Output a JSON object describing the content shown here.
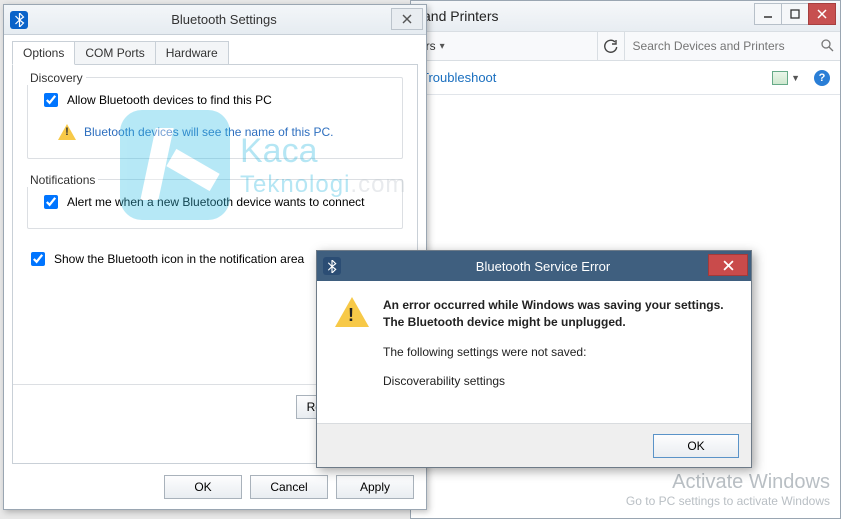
{
  "devicesWindow": {
    "title": "and Printers",
    "crumb": "ers",
    "searchPlaceholder": "Search Devices and Printers",
    "troubleshoot": "Troubleshoot",
    "help": "?"
  },
  "activate": {
    "l1": "Activate Windows",
    "l2": "Go to PC settings to activate Windows"
  },
  "btSettings": {
    "title": "Bluetooth Settings",
    "tabs": {
      "options": "Options",
      "com": "COM Ports",
      "hw": "Hardware"
    },
    "discovery": {
      "label": "Discovery",
      "allow": "Allow Bluetooth devices to find this PC",
      "hint": "Bluetooth devices will see the name of this PC."
    },
    "notifications": {
      "label": "Notifications",
      "alert": "Alert me when a new Bluetooth device wants to connect"
    },
    "showIcon": "Show the Bluetooth icon in the notification area",
    "buttons": {
      "restore": "Restore Defaults",
      "ok": "OK",
      "cancel": "Cancel",
      "apply": "Apply"
    }
  },
  "watermark": {
    "line1a": "Kaca",
    "line2a": "Teknologi",
    "line2b": ".com"
  },
  "error": {
    "title": "Bluetooth Service Error",
    "msg1": "An error occurred while Windows was saving your settings. The Bluetooth device might be unplugged.",
    "msg2": "The following settings were not saved:",
    "msg3": "Discoverability settings",
    "ok": "OK"
  }
}
